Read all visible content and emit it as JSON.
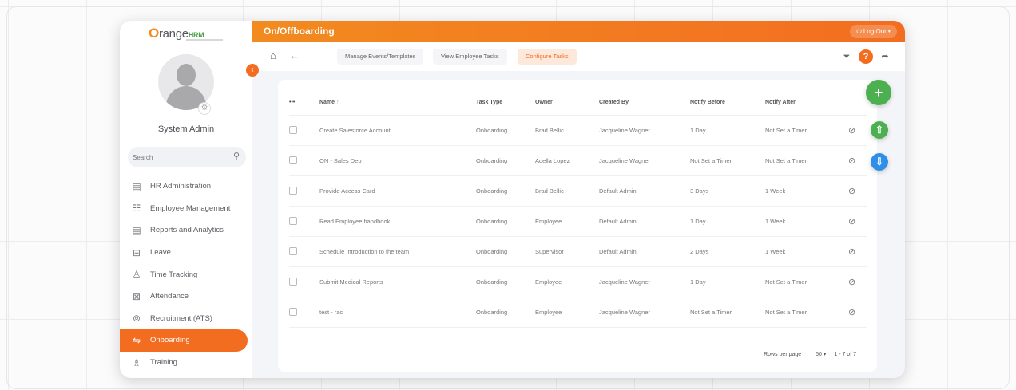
{
  "brand": {
    "name_prefix": "O",
    "name_rest": "range",
    "name_suffix": "HRM"
  },
  "sidebar": {
    "username": "System Admin",
    "search_placeholder": "Search",
    "items": [
      {
        "label": "HR Administration",
        "icon": "id-card-icon"
      },
      {
        "label": "Employee Management",
        "icon": "people-icon"
      },
      {
        "label": "Reports and Analytics",
        "icon": "report-icon"
      },
      {
        "label": "Leave",
        "icon": "leave-icon"
      },
      {
        "label": "Time Tracking",
        "icon": "clock-user-icon"
      },
      {
        "label": "Attendance",
        "icon": "attendance-icon"
      },
      {
        "label": "Recruitment (ATS)",
        "icon": "recruitment-icon"
      },
      {
        "label": "Onboarding",
        "icon": "handshake-icon"
      },
      {
        "label": "Training",
        "icon": "training-icon"
      }
    ],
    "active_index": 7
  },
  "header": {
    "title": "On/Offboarding",
    "logout_label": "Log Out"
  },
  "toolbar": {
    "tabs": [
      "Manage Events/Templates",
      "View Employee Tasks",
      "Configure Tasks"
    ],
    "active_tab": 2
  },
  "table": {
    "columns": [
      "Name",
      "Task Type",
      "Owner",
      "Created By",
      "Notify Before",
      "Notify After"
    ],
    "rows": [
      [
        "Create Salesforce Account",
        "Onboarding",
        "Brad Bellic",
        "Jacqueline Wagner",
        "1 Day",
        "Not Set a Timer"
      ],
      [
        "ON - Sales Dep",
        "Onboarding",
        "Adella Lopez",
        "Jacqueline Wagner",
        "Not Set a Timer",
        "Not Set a Timer"
      ],
      [
        "Provide Access Card",
        "Onboarding",
        "Brad Bellic",
        "Default Admin",
        "3 Days",
        "1 Week"
      ],
      [
        "Read Employee handbook",
        "Onboarding",
        "Employee",
        "Default Admin",
        "1 Day",
        "1 Week"
      ],
      [
        "Schedule Introduction to the team",
        "Onboarding",
        "Supervisor",
        "Default Admin",
        "2 Days",
        "1 Week"
      ],
      [
        "Submit Medical Reports",
        "Onboarding",
        "Employee",
        "Jacqueline Wagner",
        "1 Day",
        "Not Set a Timer"
      ],
      [
        "test - rac",
        "Onboarding",
        "Employee",
        "Jacqueline Wagner",
        "Not Set a Timer",
        "Not Set a Timer"
      ]
    ]
  },
  "pagination": {
    "rows_per_page_label": "Rows per page",
    "rows_per_page": "50",
    "range": "1 - 7 of 7"
  },
  "colors": {
    "accent": "#f36d21",
    "green": "#4caf50",
    "blue": "#2f8fe8"
  }
}
